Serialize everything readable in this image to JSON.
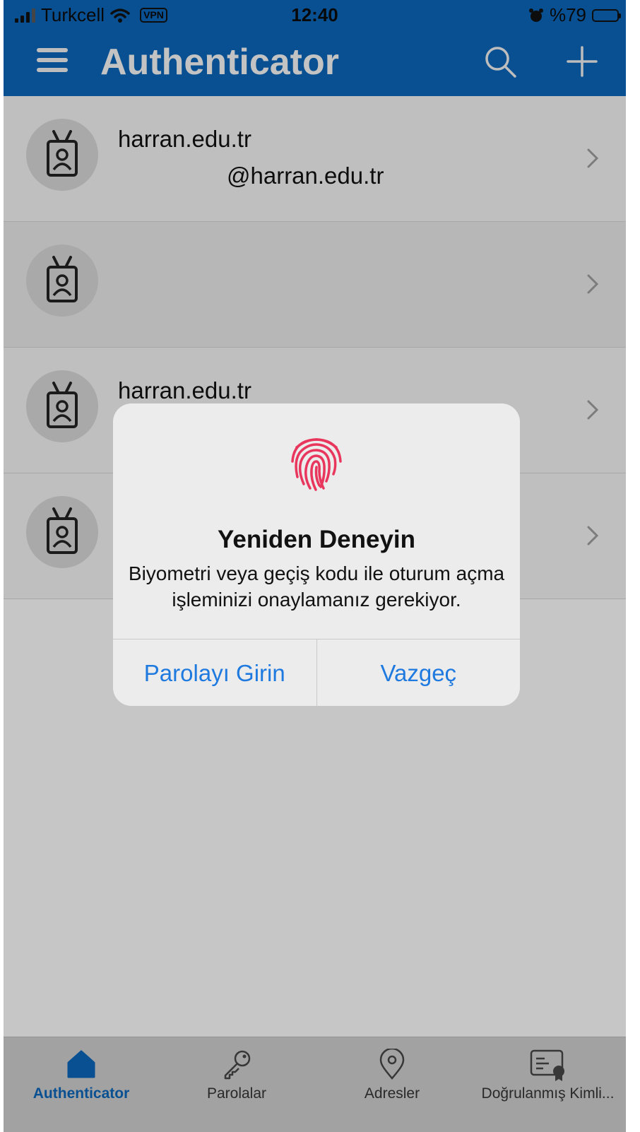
{
  "status": {
    "carrier": "Turkcell",
    "vpn": "VPN",
    "time": "12:40",
    "battery": "%79",
    "battery_level": 0.79
  },
  "header": {
    "title": "Authenticator",
    "icons": [
      "menu-icon",
      "search-icon",
      "plus-icon"
    ]
  },
  "accounts": [
    {
      "name": "harran.edu.tr",
      "email": "@harran.edu.tr"
    },
    {
      "name": "",
      "email": ""
    },
    {
      "name": "harran.edu.tr",
      "email": ""
    },
    {
      "name": "",
      "email": ""
    }
  ],
  "alert": {
    "icon": "fingerprint-icon",
    "title": "Yeniden Deneyin",
    "message": "Biyometri veya geçiş kodu ile oturum açma işleminizi onaylamanız gerekiyor.",
    "primary_button": "Parolayı Girin",
    "cancel_button": "Vazgeç"
  },
  "tabs": [
    {
      "label": "Authenticator",
      "icon": "home-icon",
      "active": true
    },
    {
      "label": "Parolalar",
      "icon": "key-icon",
      "active": false
    },
    {
      "label": "Adresler",
      "icon": "location-pin-icon",
      "active": false
    },
    {
      "label": "Doğrulanmış Kimli...",
      "icon": "verified-id-icon",
      "active": false
    }
  ],
  "colors": {
    "brand": "#0a63b4",
    "link": "#1f7ae0",
    "fingerprint": "#e8365d"
  }
}
